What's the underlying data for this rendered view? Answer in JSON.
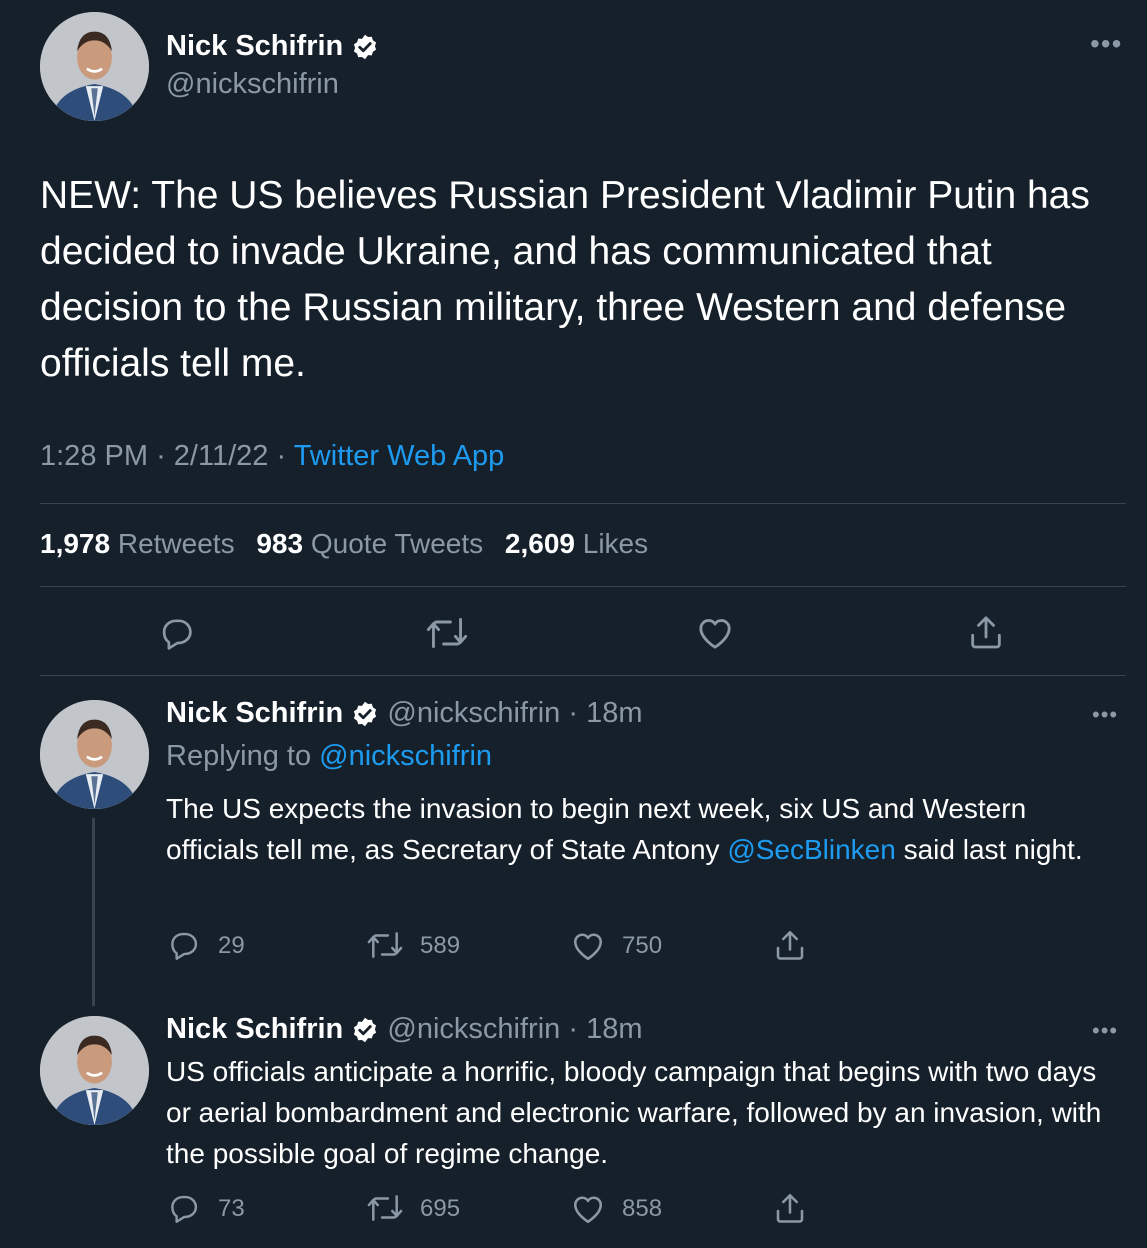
{
  "main_tweet": {
    "name": "Nick Schifrin",
    "handle": "@nickschifrin",
    "text": "NEW: The US believes Russian President Vladimir Putin has decided to invade Ukraine, and has communicated that decision to the Russian military, three Western and defense officials tell me.",
    "time": "1:28 PM",
    "date": "2/11/22",
    "separator": "·",
    "source": "Twitter Web App",
    "retweets_count": "1,978",
    "retweets_label": "Retweets",
    "quotes_count": "983",
    "quotes_label": "Quote Tweets",
    "likes_count": "2,609",
    "likes_label": "Likes"
  },
  "replies": [
    {
      "name": "Nick Schifrin",
      "handle": "@nickschifrin",
      "separator": "·",
      "age": "18m",
      "replying_label": "Replying to",
      "replying_handle": "@nickschifrin",
      "text_before": "The US expects the invasion to begin next week, six US and Western officials tell me, as Secretary of State Antony ",
      "mention": "@SecBlinken",
      "text_after": " said last night.",
      "reply_count": "29",
      "retweet_count": "589",
      "like_count": "750"
    },
    {
      "name": "Nick Schifrin",
      "handle": "@nickschifrin",
      "separator": "·",
      "age": "18m",
      "text": "US officials anticipate a horrific, bloody campaign that begins with two days or aerial bombardment and electronic warfare, followed by an invasion, with the possible goal of regime change.",
      "reply_count": "73",
      "retweet_count": "695",
      "like_count": "858"
    }
  ],
  "colors": {
    "background": "#15202b",
    "link": "#1d9bf0",
    "muted": "#8b98a5",
    "divider": "#38444d"
  },
  "icons": {
    "more": "more-icon",
    "verified": "verified-badge-icon",
    "reply": "reply-icon",
    "retweet": "retweet-icon",
    "like": "like-icon",
    "share": "share-icon"
  }
}
